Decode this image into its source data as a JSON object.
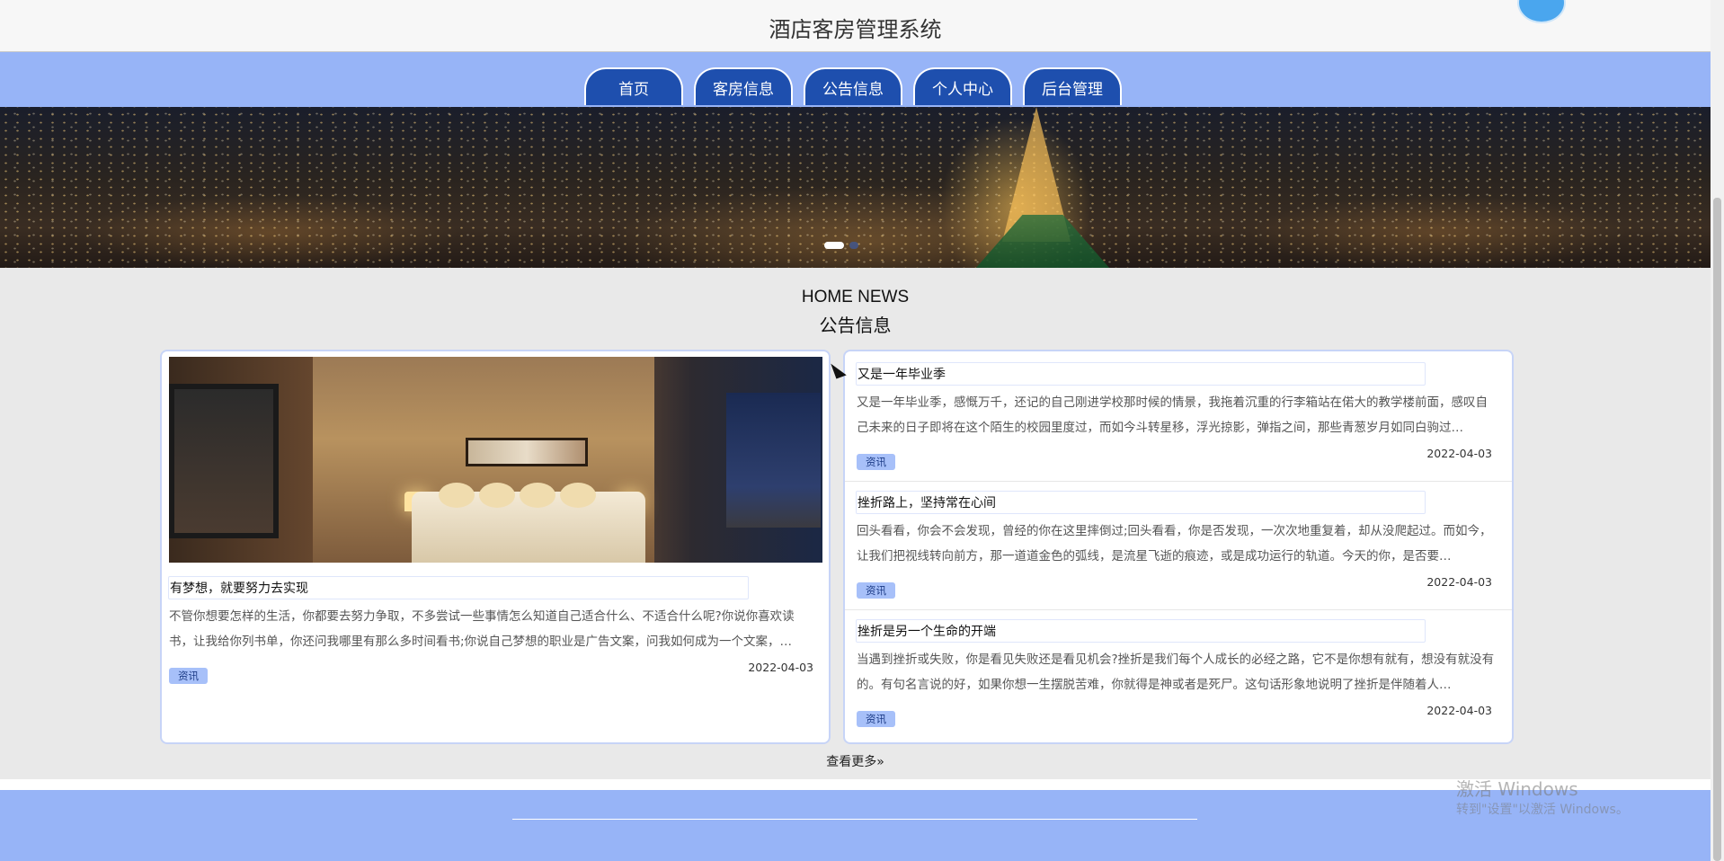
{
  "header": {
    "title": "酒店客房管理系统"
  },
  "nav": {
    "items": [
      {
        "label": "首页"
      },
      {
        "label": "客房信息"
      },
      {
        "label": "公告信息"
      },
      {
        "label": "个人中心"
      },
      {
        "label": "后台管理"
      }
    ]
  },
  "banner": {
    "slides": 2,
    "active": 1
  },
  "news": {
    "heading_en": "HOME NEWS",
    "heading_cn": "公告信息",
    "featured": {
      "title": "有梦想，就要努力去实现",
      "desc": "不管你想要怎样的生活，你都要去努力争取，不多尝试一些事情怎么知道自己适合什么、不适合什么呢?你说你喜欢读书，让我给你列书单，你还问我哪里有那么多时间看书;你说自己梦想的职业是广告文案，问我如何成为一个文案，…",
      "tag": "资讯",
      "date": "2022-04-03"
    },
    "list": [
      {
        "title": "又是一年毕业季",
        "desc": "又是一年毕业季，感慨万千，还记的自己刚进学校那时候的情景，我拖着沉重的行李箱站在偌大的教学楼前面，感叹自己未来的日子即将在这个陌生的校园里度过，而如今斗转星移，浮光掠影，弹指之间，那些青葱岁月如同白驹过…",
        "tag": "资讯",
        "date": "2022-04-03"
      },
      {
        "title": "挫折路上，坚持常在心间",
        "desc": "回头看看，你会不会发现，曾经的你在这里摔倒过;回头看看，你是否发现，一次次地重复着，却从没爬起过。而如今，让我们把视线转向前方，那一道道金色的弧线，是流星飞逝的痕迹，或是成功运行的轨道。今天的你，是否要…",
        "tag": "资讯",
        "date": "2022-04-03"
      },
      {
        "title": "挫折是另一个生命的开端",
        "desc": "当遇到挫折或失败，你是看见失败还是看见机会?挫折是我们每个人成长的必经之路，它不是你想有就有，想没有就没有的。有句名言说的好，如果你想一生摆脱苦难，你就得是神或者是死尸。这句话形象地说明了挫折是伴随着人…",
        "tag": "资讯",
        "date": "2022-04-03"
      }
    ],
    "more_label": "查看更多»"
  },
  "watermark": {
    "line1": "激活 Windows",
    "line2": "转到\"设置\"以激活 Windows。"
  },
  "colors": {
    "nav_bg": "#97b4f7",
    "nav_item": "#1e4fae",
    "tag_bg": "#a7c0f9"
  }
}
